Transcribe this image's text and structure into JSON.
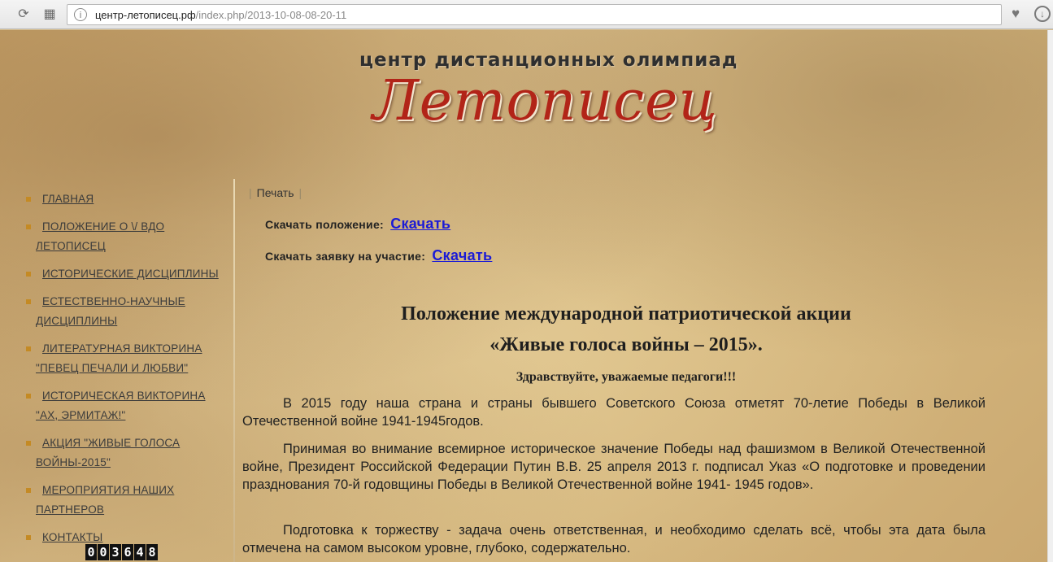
{
  "browser": {
    "url_domain": "центр-летописец.рф",
    "url_path": "/index.php/2013-10-08-08-20-11"
  },
  "header": {
    "subtitle": "центр дистанционных олимпиад",
    "title": "Летописец"
  },
  "sidebar": {
    "items": [
      {
        "line1": "ГЛАВНАЯ",
        "line2": ""
      },
      {
        "line1": "ПОЛОЖЕНИЕ О \\/ ВДО",
        "line2": "ЛЕТОПИСЕЦ"
      },
      {
        "line1": "ИСТОРИЧЕСКИЕ ДИСЦИПЛИНЫ",
        "line2": ""
      },
      {
        "line1": "ЕСТЕСТВЕННО-НАУЧНЫЕ",
        "line2": "ДИСЦИПЛИНЫ"
      },
      {
        "line1": "ЛИТЕРАТУРНАЯ ВИКТОРИНА",
        "line2": "\"ПЕВЕЦ ПЕЧАЛИ И ЛЮБВИ\""
      },
      {
        "line1": "ИСТОРИЧЕСКАЯ ВИКТОРИНА",
        "line2": "\"АХ, ЭРМИТАЖ!\""
      },
      {
        "line1": "АКЦИЯ \"ЖИВЫЕ ГОЛОСА",
        "line2": "ВОЙНЫ-2015\""
      },
      {
        "line1": "МЕРОПРИЯТИЯ НАШИХ",
        "line2": "ПАРТНЕРОВ"
      },
      {
        "line1": "КОНТАКТЫ",
        "line2": ""
      }
    ],
    "counter": [
      "0",
      "0",
      "3",
      "6",
      "4",
      "8"
    ]
  },
  "content": {
    "print_label": "Печать",
    "download_rules_label": "Скачать положение:",
    "download_rules_link": "Скачать",
    "download_application_label": "Скачать заявку на участие:",
    "download_application_link": "Скачать",
    "title_line1": "Положение международной патриотической акции",
    "title_line2": "«Живые голоса войны – 2015».",
    "greeting": "Здравствуйте, уважаемые педагоги!!!",
    "paragraphs": [
      "В 2015 году наша страна и страны бывшего Советского Союза отметят 70-летие Победы в Великой Отечественной войне 1941-1945годов.",
      "Принимая во внимание всемирное историческое значение Победы над фашизмом в Великой Отечественной войне, Президент Российской Федерации Путин В.В. 25 апреля 2013 г. подписал Указ «О подготовке и проведении празднования 70-й годовщины Победы в Великой Отечественной войне 1941- 1945 годов».",
      "Подготовка к торжеству - задача очень ответственная, и необходимо сделать всё, чтобы эта дата была отмечена на самом высоком уровне, глубоко, содержательно."
    ]
  }
}
